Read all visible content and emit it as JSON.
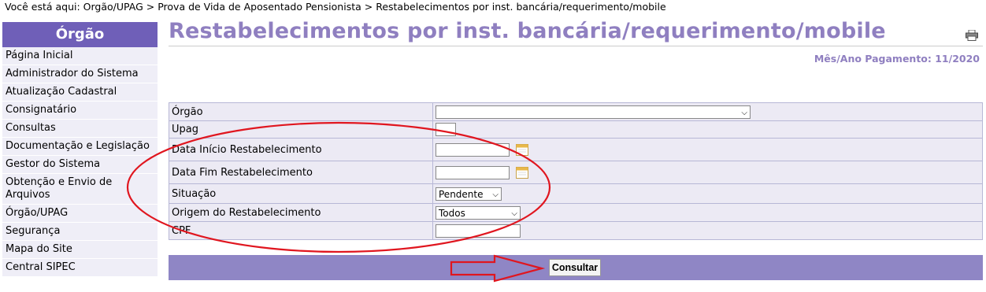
{
  "breadcrumb": "Você está aqui:  Orgão/UPAG > Prova de Vida de Aposentado Pensionista > Restabelecimentos por inst. bancária/requerimento/mobile",
  "sidebar": {
    "header": "Órgão",
    "items": [
      {
        "label": "Página Inicial"
      },
      {
        "label": "Administrador do Sistema"
      },
      {
        "label": "Atualização Cadastral"
      },
      {
        "label": "Consignatário"
      },
      {
        "label": "Consultas"
      },
      {
        "label": "Documentação e Legislação"
      },
      {
        "label": "Gestor do Sistema"
      },
      {
        "label": "Obtenção e Envio de Arquivos"
      },
      {
        "label": "Órgão/UPAG"
      },
      {
        "label": "Segurança"
      },
      {
        "label": "Mapa do Site"
      },
      {
        "label": "Central SIPEC"
      }
    ]
  },
  "page": {
    "title": "Restabelecimentos por inst. bancária/requerimento/mobile",
    "payment_period": "Mês/Ano Pagamento: 11/2020"
  },
  "form": {
    "orgao_label": "Órgão",
    "orgao_value": "",
    "upag_label": "Upag",
    "upag_value": "",
    "data_inicio_label": "Data Início Restabelecimento",
    "data_fim_label": "Data Fim Restabelecimento",
    "situacao_label": "Situação",
    "situacao_value": "Pendente",
    "origem_label": "Origem do Restabelecimento",
    "origem_value": "Todos",
    "cpf_label": "CPF",
    "cpf_value": ""
  },
  "actions": {
    "consultar_label": "Consultar"
  },
  "colors": {
    "accent": "#6f5fb8",
    "title": "#8f7fc0",
    "annotation": "#e0161f"
  }
}
